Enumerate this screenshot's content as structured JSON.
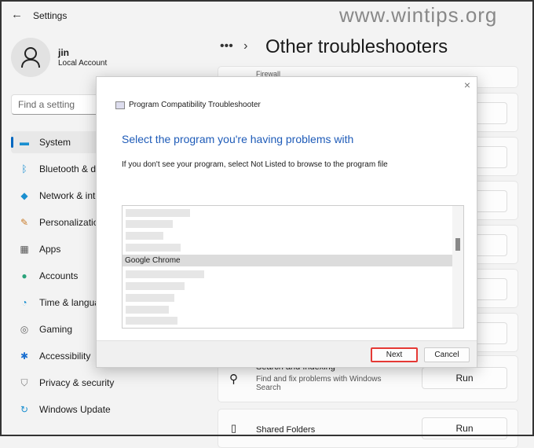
{
  "window": {
    "title": "Settings",
    "back_icon": "arrow-left-icon"
  },
  "watermark": "www.wintips.org",
  "user": {
    "name": "jin",
    "account": "Local Account"
  },
  "search": {
    "placeholder": "Find a setting"
  },
  "sidebar": {
    "items": [
      {
        "label": "System",
        "icon": "monitor-icon",
        "selected": true
      },
      {
        "label": "Bluetooth & devices",
        "icon": "bluetooth-icon"
      },
      {
        "label": "Network & internet",
        "icon": "wifi-icon"
      },
      {
        "label": "Personalization",
        "icon": "brush-icon"
      },
      {
        "label": "Apps",
        "icon": "apps-icon"
      },
      {
        "label": "Accounts",
        "icon": "person-icon"
      },
      {
        "label": "Time & language",
        "icon": "globe-clock-icon"
      },
      {
        "label": "Gaming",
        "icon": "gamepad-icon"
      },
      {
        "label": "Accessibility",
        "icon": "accessibility-icon"
      },
      {
        "label": "Privacy & security",
        "icon": "shield-icon"
      },
      {
        "label": "Windows Update",
        "icon": "update-icon"
      }
    ]
  },
  "header": {
    "more": "•••",
    "sep": "›",
    "title": "Other troubleshooters"
  },
  "cards": {
    "firewall": "Firewall",
    "search": {
      "title": "Search and Indexing",
      "desc": "Find and fix problems with Windows Search",
      "run": "Run"
    },
    "shared": {
      "title": "Shared Folders",
      "run": "Run"
    }
  },
  "dialog": {
    "title": "Program Compatibility Troubleshooter",
    "close": "×",
    "heading": "Select the program you're having problems with",
    "subtext": "If you don't see your program, select Not Listed to browse to the program file",
    "selected_item": "Google Chrome",
    "next": "Next",
    "cancel": "Cancel"
  }
}
